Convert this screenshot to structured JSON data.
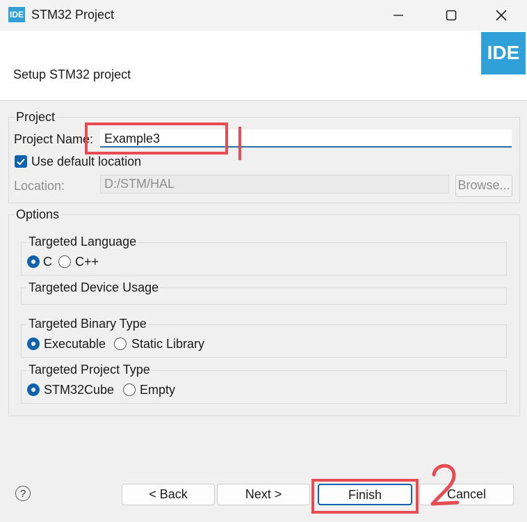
{
  "window": {
    "title": "STM32 Project",
    "app_icon_text": "IDE",
    "min_glyph": "—",
    "max_glyph": "☐",
    "close_glyph": "✕"
  },
  "banner": {
    "title": "Setup STM32 project",
    "logo_text": "IDE"
  },
  "project": {
    "group_title": "Project",
    "name_label_prefix": "Project Nam",
    "name_label_suffix": "e:",
    "name_value": "Example3",
    "use_default_location_label": "Use default location",
    "location_label": "Location:",
    "location_value": "D:/STM/HAL",
    "browse_label": "Browse..."
  },
  "options": {
    "group_title": "Options",
    "language": {
      "title": "Targeted Language",
      "options": [
        "C",
        "C++"
      ],
      "selected": "C"
    },
    "device_usage": {
      "title": "Targeted Device Usage"
    },
    "binary_type": {
      "title": "Targeted Binary Type",
      "options": [
        "Executable",
        "Static Library"
      ],
      "selected": "Executable"
    },
    "project_type": {
      "title": "Targeted Project Type",
      "options": [
        "STM32Cube",
        "Empty"
      ],
      "selected": "STM32Cube"
    }
  },
  "buttons": {
    "help": "?",
    "back": "< Back",
    "next": "Next >",
    "finish": "Finish",
    "cancel": "Cancel"
  },
  "annotations": {
    "step1": "1",
    "step2": "2",
    "color": "#e84c52"
  }
}
